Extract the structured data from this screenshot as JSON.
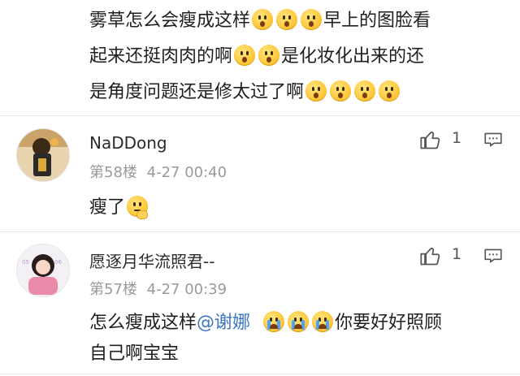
{
  "top_comment": {
    "line1": "雾草怎么会瘦成这样",
    "line1_tail": "早上的图脸看",
    "line2": "起来还挺肉肉的啊",
    "line2_tail": "是化妆化出来的还",
    "line3": "是角度问题还是修太过了啊"
  },
  "comments": [
    {
      "user": "NaDDong",
      "floor": "第58楼",
      "time": "4-27 00:40",
      "likes": "1",
      "text": "瘦了"
    },
    {
      "user": "愿逐月华流照君--",
      "floor": "第57楼",
      "time": "4-27 00:39",
      "likes": "1",
      "text_pre": "怎么瘦成这样",
      "mention": "@谢娜",
      "text_post": "你要好好照顾",
      "text_line2": "自己啊宝宝"
    }
  ],
  "icons": {
    "like": "thumbs-up-icon",
    "reply": "comment-icon",
    "emoji_shock": "shocked-face-emoji",
    "emoji_cry": "crying-face-emoji",
    "emoji_think": "thinking-face-emoji"
  },
  "colors": {
    "mention": "#3d75c0",
    "meta": "#9a9a9a"
  }
}
